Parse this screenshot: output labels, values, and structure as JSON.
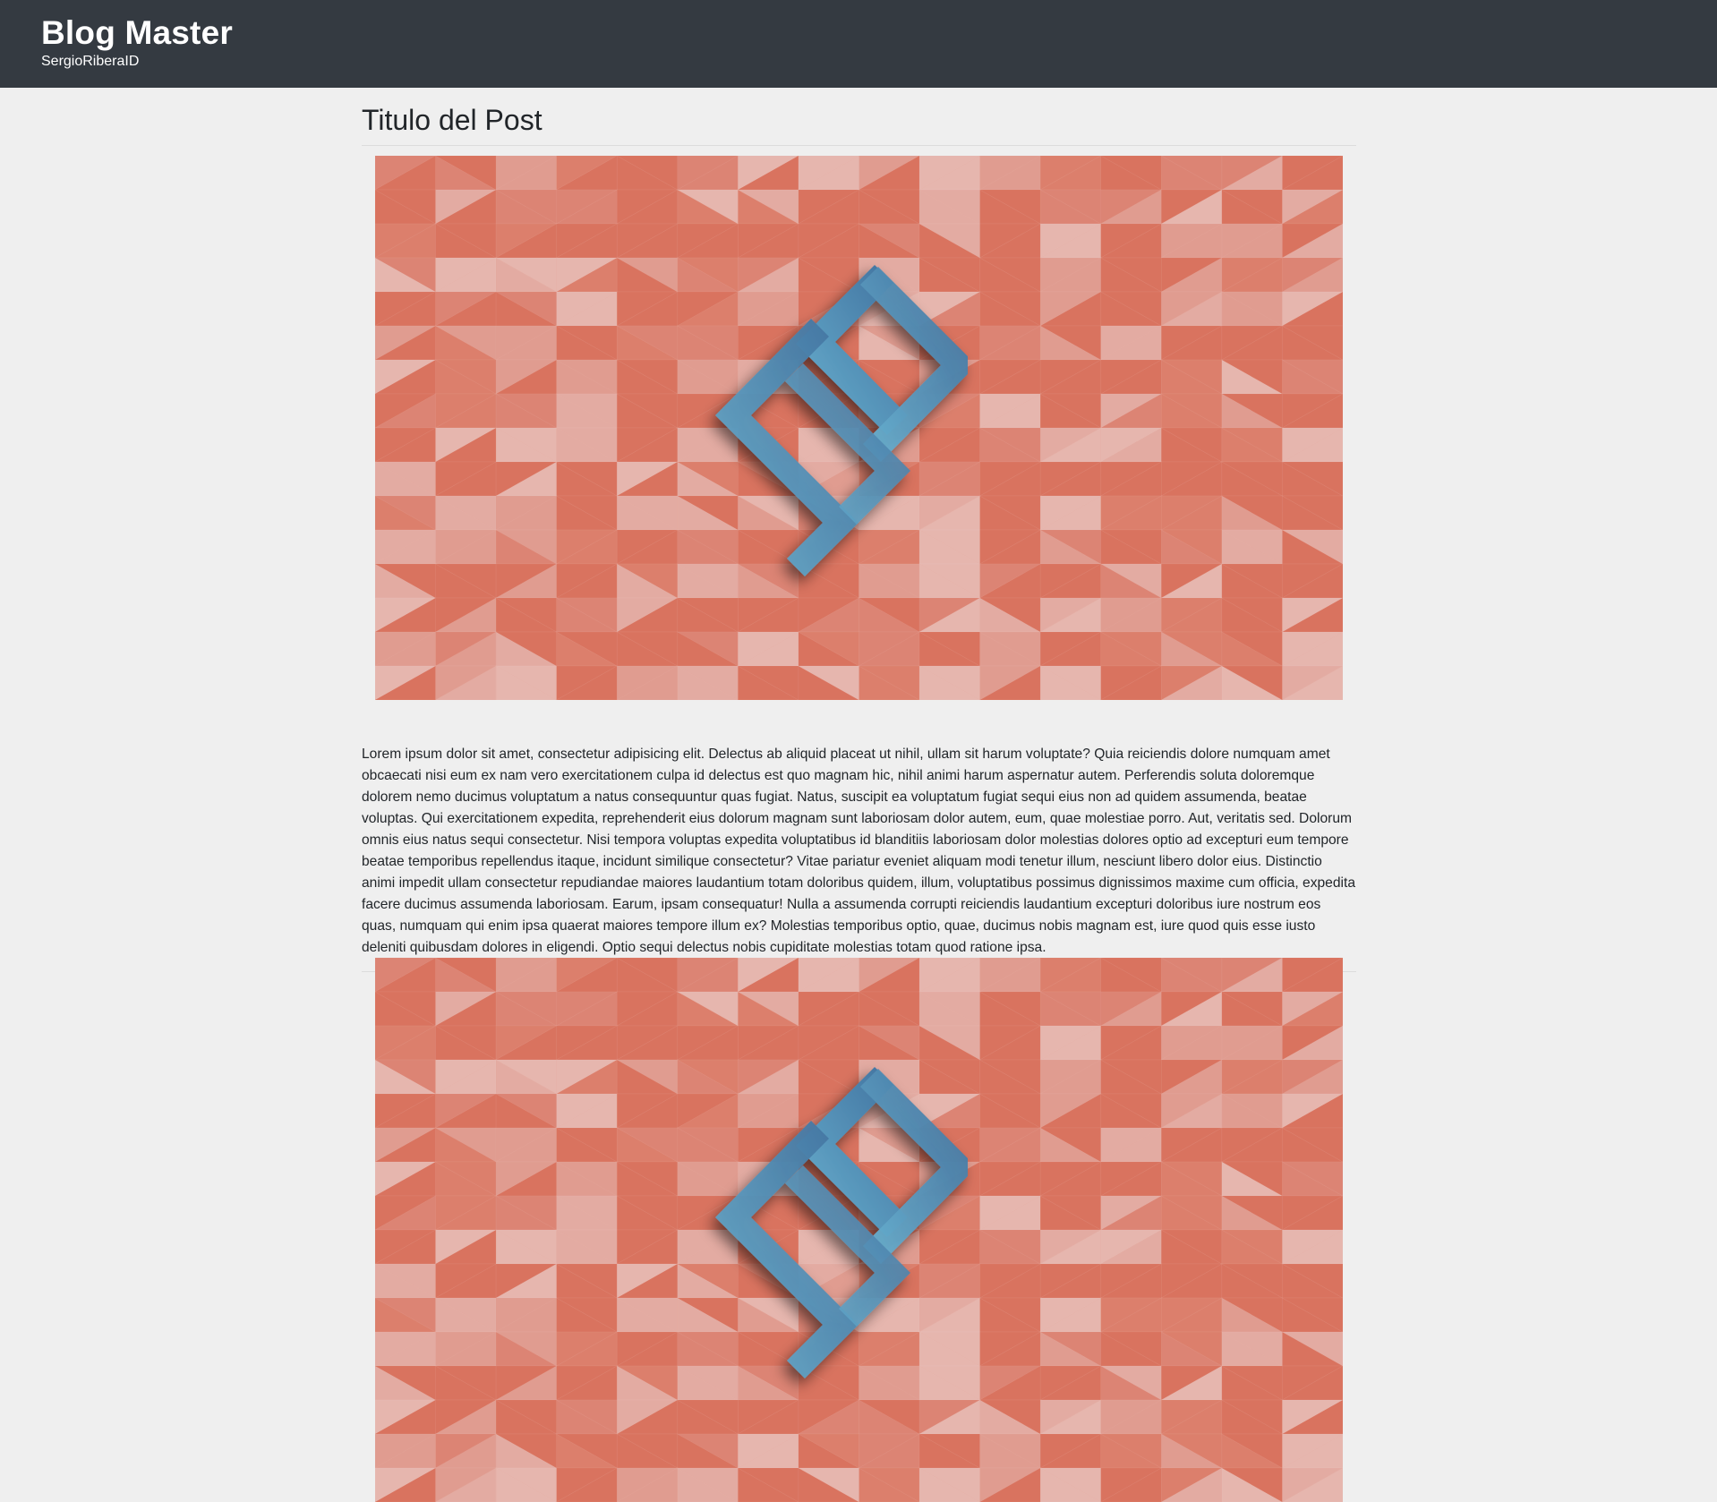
{
  "header": {
    "brand_title": "Blog Master",
    "brand_subtitle": "SergioRiberaID"
  },
  "posts": [
    {
      "title": "Titulo del Post",
      "image_alt": "",
      "body": "Lorem ipsum dolor sit amet, consectetur adipisicing elit. Delectus ab aliquid placeat ut nihil, ullam sit harum voluptate? Quia reiciendis dolore numquam amet obcaecati nisi eum ex nam vero exercitationem culpa id delectus est quo magnam hic, nihil animi harum aspernatur autem. Perferendis soluta doloremque dolorem nemo ducimus voluptatum a natus consequuntur quas fugiat. Natus, suscipit ea voluptatum fugiat sequi eius non ad quidem assumenda, beatae voluptas. Qui exercitationem expedita, reprehenderit eius dolorum magnam sunt laboriosam dolor autem, eum, quae molestiae porro. Aut, veritatis sed. Dolorum omnis eius natus sequi consectetur. Nisi tempora voluptas expedita voluptatibus id blanditiis laboriosam dolor molestias dolores optio ad excepturi eum tempore beatae temporibus repellendus itaque, incidunt similique consectetur? Vitae pariatur eveniet aliquam modi tenetur illum, nesciunt libero dolor eius. Distinctio animi impedit ullam consectetur repudiandae maiores laudantium totam doloribus quidem, illum, voluptatibus possimus dignissimos maxime cum officia, expedita facere ducimus assumenda laboriosam. Earum, ipsam consequatur! Nulla a assumenda corrupti reiciendis laudantium excepturi doloribus iure nostrum eos quas, numquam qui enim ipsa quaerat maiores tempore illum ex? Molestias temporibus optio, quae, ducimus nobis magnam est, iure quod quis esse iusto deleniti quibusdam dolores in eligendi. Optio sequi delectus nobis cupiditate molestias totam quod ratione ipsa."
    }
  ],
  "colors": {
    "header_bg": "#343a41",
    "page_bg": "#efefef",
    "image_base": "#d9735f",
    "logo_blue_dark": "#3f6e9c",
    "logo_blue_light": "#6ab4d2"
  },
  "icons": {
    "logo": "code-bracket-logo"
  }
}
